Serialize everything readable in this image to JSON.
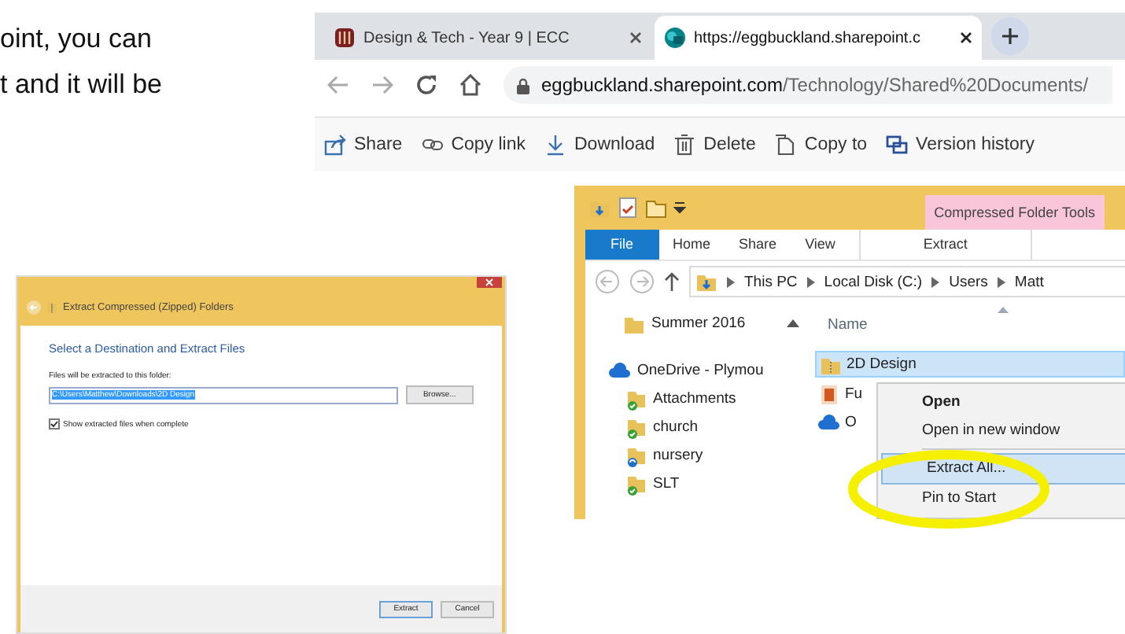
{
  "document_text": [
    "oint, you can",
    "t and it will be"
  ],
  "browser": {
    "tabs": [
      {
        "title": "Design & Tech - Year 9 | ECC",
        "kind": "school",
        "selected": false
      },
      {
        "title": "https://eggbuckland.sharepoint.c",
        "kind": "sharepoint",
        "selected": true
      }
    ],
    "address": {
      "host": "eggbuckland.sharepoint.com",
      "path": "/Technology/Shared%20Documents/"
    },
    "actions": [
      {
        "label": "Share",
        "kind": "share"
      },
      {
        "label": "Copy link",
        "kind": "link"
      },
      {
        "label": "Download",
        "kind": "download"
      },
      {
        "label": "Delete",
        "kind": "delete"
      },
      {
        "label": "Copy to",
        "kind": "copy"
      },
      {
        "label": "Version history",
        "kind": "history"
      }
    ]
  },
  "explorer": {
    "context_label": "Compressed Folder Tools",
    "ribbon_tabs": [
      {
        "label": "File",
        "kind": "file",
        "selected": false
      },
      {
        "label": "Home",
        "kind": "tab",
        "selected": false
      },
      {
        "label": "Share",
        "kind": "tab",
        "selected": false
      },
      {
        "label": "View",
        "kind": "tab",
        "selected": false
      },
      {
        "label": "Extract",
        "kind": "tab",
        "selected": false
      }
    ],
    "breadcrumb": [
      "This PC",
      "Local Disk (C:)",
      "Users",
      "Matt"
    ],
    "nav_items": [
      {
        "label": "Summer 2016",
        "kind": "folder"
      },
      {
        "label": "OneDrive - Plymou",
        "kind": "cloud"
      },
      {
        "label": "Attachments",
        "kind": "synced"
      },
      {
        "label": "church",
        "kind": "synced"
      },
      {
        "label": "nursery",
        "kind": "syncing"
      },
      {
        "label": "SLT",
        "kind": "synced"
      }
    ],
    "column": "Name",
    "files": [
      {
        "name": "2D Design",
        "kind": "zip",
        "selected": true
      },
      {
        "name": "Fu",
        "kind": "app",
        "selected": false
      },
      {
        "name": "O",
        "kind": "cloud",
        "selected": false
      }
    ],
    "context_menu": [
      {
        "label": "Open",
        "default": true,
        "selected": false
      },
      {
        "label": "Open in new window",
        "default": false,
        "selected": false
      },
      {
        "label": "Extract All...",
        "default": false,
        "selected": true
      },
      {
        "label": "Pin to Start",
        "default": false,
        "selected": false
      }
    ]
  },
  "dialog": {
    "title": "Extract Compressed (Zipped) Folders",
    "heading": "Select a Destination and Extract Files",
    "field_label": "Files will be extracted to this folder:",
    "path": "C:\\Users\\Matthew\\Downloads\\2D Design",
    "browse": "Browse...",
    "show_files": {
      "label": "Show extracted files when complete",
      "checked": true
    },
    "buttons": [
      "Extract",
      "Cancel"
    ]
  }
}
